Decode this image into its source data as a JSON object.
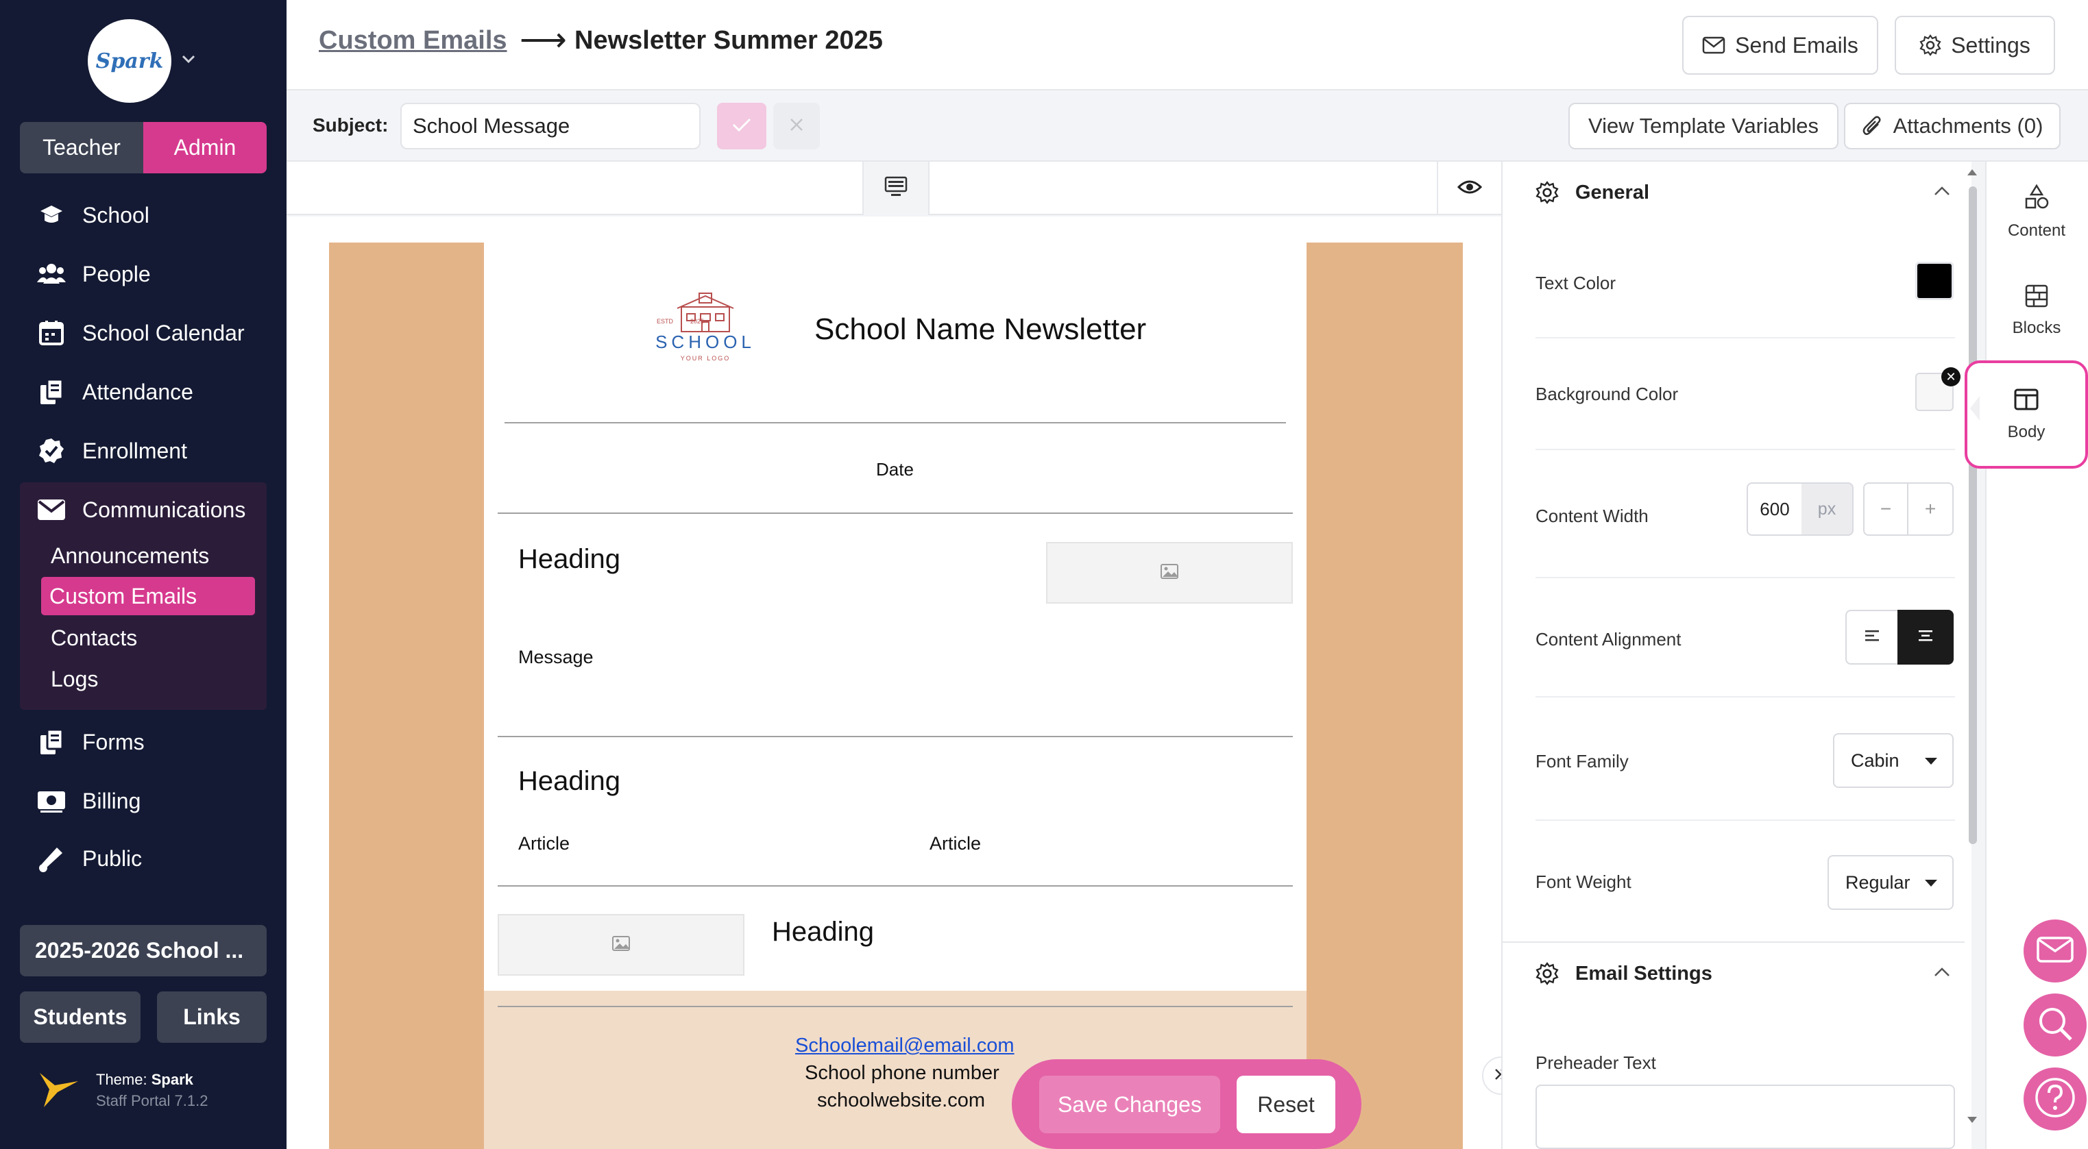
{
  "sidebar": {
    "logo_text": "Spark",
    "role_toggle": {
      "teacher": "Teacher",
      "admin": "Admin"
    },
    "nav": [
      {
        "label": "School",
        "icon": "school-icon"
      },
      {
        "label": "People",
        "icon": "people-icon"
      },
      {
        "label": "School Calendar",
        "icon": "calendar-icon"
      },
      {
        "label": "Attendance",
        "icon": "attendance-icon"
      },
      {
        "label": "Enrollment",
        "icon": "enrollment-check-icon"
      },
      {
        "label": "Communications",
        "icon": "envelope-icon"
      }
    ],
    "communications_sub": [
      "Announcements",
      "Custom Emails",
      "Contacts",
      "Logs"
    ],
    "nav_lower": [
      {
        "label": "Forms",
        "icon": "forms-icon"
      },
      {
        "label": "Billing",
        "icon": "billing-icon"
      },
      {
        "label": "Public",
        "icon": "megaphone-icon"
      }
    ],
    "school_year": "2025-2026 School ...",
    "students_btn": "Students",
    "links_btn": "Links",
    "theme_label": "Theme:",
    "theme_name": "Spark",
    "version": "Staff Portal 7.1.2"
  },
  "header": {
    "breadcrumb_link": "Custom Emails",
    "arrow": "⟶",
    "title": "Newsletter Summer 2025",
    "send_emails": "Send Emails",
    "settings": "Settings"
  },
  "subject_bar": {
    "label": "Subject:",
    "value": "School Message",
    "view_template_vars": "View Template Variables",
    "attachments": "Attachments (0)"
  },
  "email": {
    "logo_top": "ESTD          2025",
    "logo_word": "SCHOOL",
    "logo_sub": "YOUR LOGO",
    "title": "School Name Newsletter",
    "date": "Date",
    "heading1": "Heading",
    "message": "Message",
    "heading2": "Heading",
    "article1": "Article",
    "article2": "Article",
    "heading3": "Heading",
    "footer_email": "Schoolemail@email.com",
    "footer_phone": "School phone number",
    "footer_web": "schoolwebsite.com"
  },
  "actions": {
    "save": "Save Changes",
    "reset": "Reset"
  },
  "panel": {
    "general_title": "General",
    "text_color_label": "Text Color",
    "text_color": "#000000",
    "bg_color_label": "Background Color",
    "content_width_label": "Content Width",
    "content_width": "600",
    "content_width_unit": "px",
    "content_alignment_label": "Content Alignment",
    "content_alignment": "center",
    "font_family_label": "Font Family",
    "font_family": "Cabin",
    "font_weight_label": "Font Weight",
    "font_weight": "Regular",
    "email_settings_title": "Email Settings",
    "preheader_label": "Preheader Text"
  },
  "rail": {
    "content": "Content",
    "blocks": "Blocks",
    "body": "Body"
  },
  "colors": {
    "accent": "#d63a8e",
    "sidebar": "#141a33",
    "email_bg": "#e4b489",
    "footer": "#f1dcc8"
  }
}
